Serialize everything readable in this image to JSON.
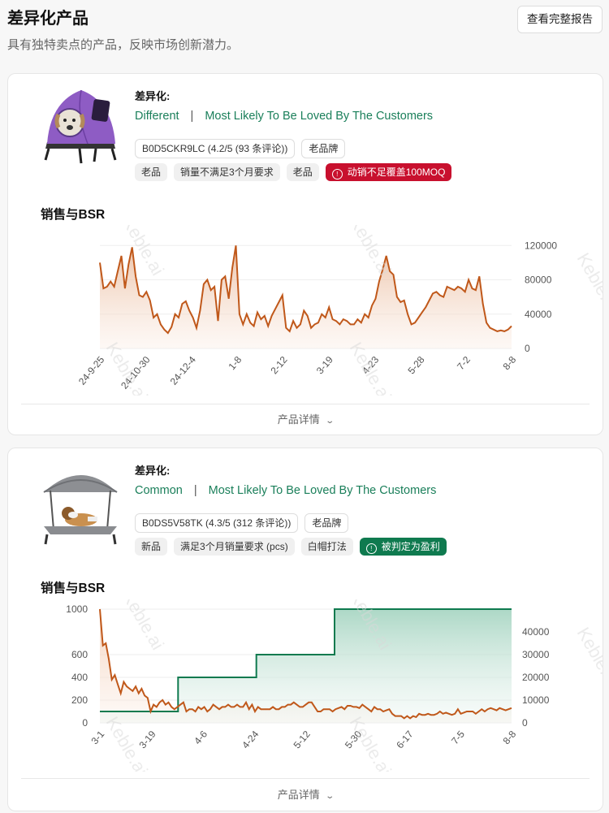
{
  "header": {
    "title": "差异化产品",
    "subtitle": "具有独特卖点的产品，反映市场创新潜力。",
    "report_button": "查看完整报告"
  },
  "products": [
    {
      "image_icon": "pet-tent-bed-icon",
      "diff_label": "差异化:",
      "diff_type": "Different",
      "separator": "|",
      "tagline": "Most Likely To Be Loved By The Customers",
      "asin_rating": "B0D5CKR9LC (4.2/5 (93 条评论))",
      "brand_tag": "老品牌",
      "tags": [
        "老品",
        "销量不满足3个月要求",
        "老品"
      ],
      "status_tag": "动销不足覆盖100MOQ",
      "status_color": "#c8102e",
      "chart_title": "销售与BSR",
      "details_label": "产品详情"
    },
    {
      "image_icon": "canopy-pet-cot-icon",
      "diff_label": "差异化:",
      "diff_type": "Common",
      "separator": "|",
      "tagline": "Most Likely To Be Loved By The Customers",
      "asin_rating": "B0DS5V58TK (4.3/5 (312 条评论))",
      "brand_tag": "老品牌",
      "tags": [
        "新品",
        "满足3个月销量要求 (pcs)",
        "白帽打法"
      ],
      "status_tag": "被判定为盈利",
      "status_color": "#0f7a4f",
      "chart_title": "销售与BSR",
      "details_label": "产品详情"
    }
  ],
  "watermark_text": "Keble.ai",
  "chart_data": [
    {
      "type": "area",
      "x_ticks": [
        "24-9-25",
        "24-10-30",
        "24-12-4",
        "1-8",
        "2-12",
        "3-19",
        "4-23",
        "5-28",
        "7-2",
        "8-8"
      ],
      "right_axis_ticks": [
        120000,
        80000,
        40000,
        0
      ],
      "ylim": [
        0,
        125000
      ],
      "color": "#c0581a",
      "series": [
        {
          "values": [
            100000,
            70000,
            72000,
            78000,
            72000,
            90000,
            108000,
            70000,
            98000,
            118000,
            84000,
            62000,
            60000,
            66000,
            56000,
            36000,
            40000,
            28000,
            22000,
            18000,
            25000,
            40000,
            36000,
            52000,
            55000,
            44000,
            36000,
            24000,
            44000,
            75000,
            80000,
            68000,
            72000,
            32000,
            80000,
            84000,
            58000,
            94000,
            120000,
            40000,
            28000,
            40000,
            30000,
            26000,
            42000,
            34000,
            38000,
            26000,
            38000,
            46000,
            54000,
            62000,
            24000,
            20000,
            32000,
            24000,
            28000,
            44000,
            38000,
            24000,
            28000,
            30000,
            40000,
            36000,
            48000,
            34000,
            32000,
            28000,
            34000,
            32000,
            28000,
            28000,
            34000,
            30000,
            40000,
            36000,
            50000,
            58000,
            78000,
            92000,
            108000,
            90000,
            86000,
            60000,
            54000,
            56000,
            40000,
            28000,
            30000,
            36000,
            42000,
            48000,
            56000,
            64000,
            66000,
            62000,
            60000,
            72000,
            70000,
            68000,
            72000,
            70000,
            66000,
            80000,
            70000,
            68000,
            84000,
            52000,
            30000,
            24000,
            22000,
            20000,
            21000,
            20000,
            22000,
            26000
          ]
        }
      ]
    },
    {
      "type": "line",
      "x_ticks": [
        "3-1",
        "3-19",
        "4-6",
        "4-24",
        "5-12",
        "5-30",
        "6-17",
        "7-5",
        "8-8"
      ],
      "left_axis_ticks": [
        1000,
        600,
        400,
        200,
        0
      ],
      "right_axis_ticks": [
        40000,
        30000,
        20000,
        10000,
        0
      ],
      "ylim_left": [
        0,
        1000
      ],
      "ylim_right": [
        0,
        50000
      ],
      "series": [
        {
          "type": "line",
          "color": "#c0581a",
          "values": [
            1000,
            680,
            700,
            560,
            380,
            420,
            340,
            260,
            360,
            320,
            300,
            280,
            320,
            260,
            300,
            240,
            220,
            100,
            160,
            140,
            180,
            200,
            160,
            180,
            140,
            120,
            140,
            160,
            180,
            100,
            120,
            120,
            100,
            140,
            120,
            140,
            100,
            120,
            160,
            140,
            120,
            140,
            140,
            160,
            140,
            140,
            160,
            140,
            140,
            180,
            120,
            160,
            100,
            140,
            120,
            120,
            120,
            120,
            140,
            120,
            120,
            140,
            140,
            160,
            160,
            180,
            160,
            140,
            140,
            160,
            180,
            180,
            140,
            100,
            100,
            120,
            120,
            120,
            100,
            120,
            130,
            140,
            120,
            150,
            150,
            140,
            140,
            130,
            160,
            140,
            120,
            100,
            140,
            120,
            120,
            100,
            110,
            120,
            80,
            60,
            60,
            60,
            40,
            60,
            40,
            60,
            50,
            80,
            70,
            70,
            80,
            70,
            70,
            80,
            100,
            80,
            90,
            80,
            70,
            80,
            120,
            80,
            90,
            100,
            100,
            100,
            80,
            100,
            120,
            100,
            120,
            130,
            120,
            110,
            130,
            120,
            110,
            120,
            130
          ]
        },
        {
          "type": "step-area",
          "color": "#0f7a4f",
          "x_fractions": [
            0,
            0.19,
            0.19,
            0.38,
            0.38,
            0.57,
            0.57,
            1
          ],
          "values": [
            5000,
            5000,
            20000,
            20000,
            30000,
            30000,
            50000,
            50000
          ]
        }
      ]
    }
  ]
}
